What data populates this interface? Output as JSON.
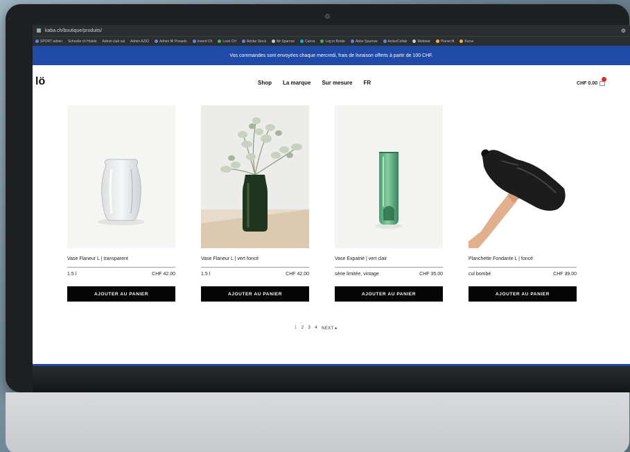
{
  "browser": {
    "url": "kaba.ch/boutique/produits/",
    "bookmarks": [
      "SPORT admin",
      "Schnelle ch Hotels",
      "Admin club sql",
      "Admin AZIO",
      "Admin fill Privaets",
      "Inverd Ch",
      "Look CH",
      "Adobe Stock",
      "Mr Sparrow",
      "Canva",
      "Log in Borde",
      "Abbo Sparrow",
      "ActiveCollab",
      "Webinar",
      "Planet fit",
      "Kurse"
    ]
  },
  "site": {
    "banner": "Vos commandes sont envoyées chaque mercredi, frais de livraison offerts à partir de 100 CHF.",
    "logo": "lö",
    "nav": [
      "Shop",
      "La marque",
      "Sur mesure",
      "FR"
    ],
    "cart_total": "CHF 0.00",
    "colors": {
      "banner": "#1f4aa8",
      "button": "#050505",
      "cart_badge": "#d72d2d"
    }
  },
  "products": [
    {
      "title": "Vase Flaneur L | transparent",
      "volume": "1.5 l",
      "price": "CHF 42.00",
      "button": "AJOUTER AU PANIER",
      "image": "clear-glass-vase"
    },
    {
      "title": "Vase Flaneur L | vert foncé",
      "volume": "1.5 l",
      "price": "CHF 42.00",
      "button": "AJOUTER AU PANIER",
      "image": "dark-green-vase-with-eucalyptus"
    },
    {
      "title": "Vase Expatrié | vert clair",
      "volume": "série limitée, vintage",
      "price": "CHF 35.00",
      "button": "AJOUTER AU PANIER",
      "image": "light-green-bottle-vase"
    },
    {
      "title": "Planchette Fondante L | foncé",
      "volume": "cul bombé",
      "price": "CHF 39.00",
      "button": "AJOUTER AU PANIER",
      "image": "dark-glass-board-in-hand"
    }
  ],
  "pagination": {
    "pages": [
      "1",
      "2",
      "3",
      "4"
    ],
    "next": "NEXT ▸"
  }
}
